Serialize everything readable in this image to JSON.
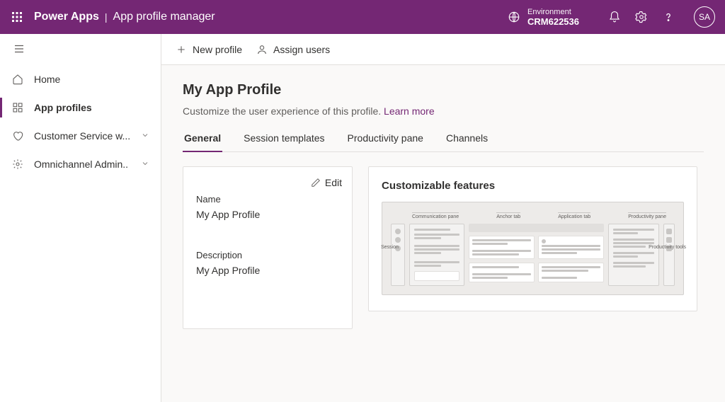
{
  "header": {
    "brand": "Power Apps",
    "page": "App profile manager",
    "env_label": "Environment",
    "env_name": "CRM622536",
    "avatar": "SA"
  },
  "sidebar": {
    "items": [
      {
        "label": "Home"
      },
      {
        "label": "App profiles"
      },
      {
        "label": "Customer Service w..."
      },
      {
        "label": "Omnichannel Admin.."
      }
    ],
    "active_index": 1
  },
  "commandbar": {
    "new_profile": "New profile",
    "assign_users": "Assign users"
  },
  "page": {
    "title": "My App Profile",
    "description": "Customize the user experience of this profile.",
    "learn_more": "Learn more"
  },
  "tabs": {
    "items": [
      "General",
      "Session templates",
      "Productivity pane",
      "Channels"
    ],
    "active_index": 0
  },
  "general_card": {
    "edit": "Edit",
    "name_label": "Name",
    "name_value": "My App Profile",
    "desc_label": "Description",
    "desc_value": "My App Profile"
  },
  "features_card": {
    "title": "Customizable features",
    "callouts": {
      "session": "Session",
      "comm": "Communication pane",
      "anchor": "Anchor tab",
      "apptab": "Application tab",
      "prodpane": "Productivity pane",
      "prodtools": "Productivity tools"
    }
  }
}
